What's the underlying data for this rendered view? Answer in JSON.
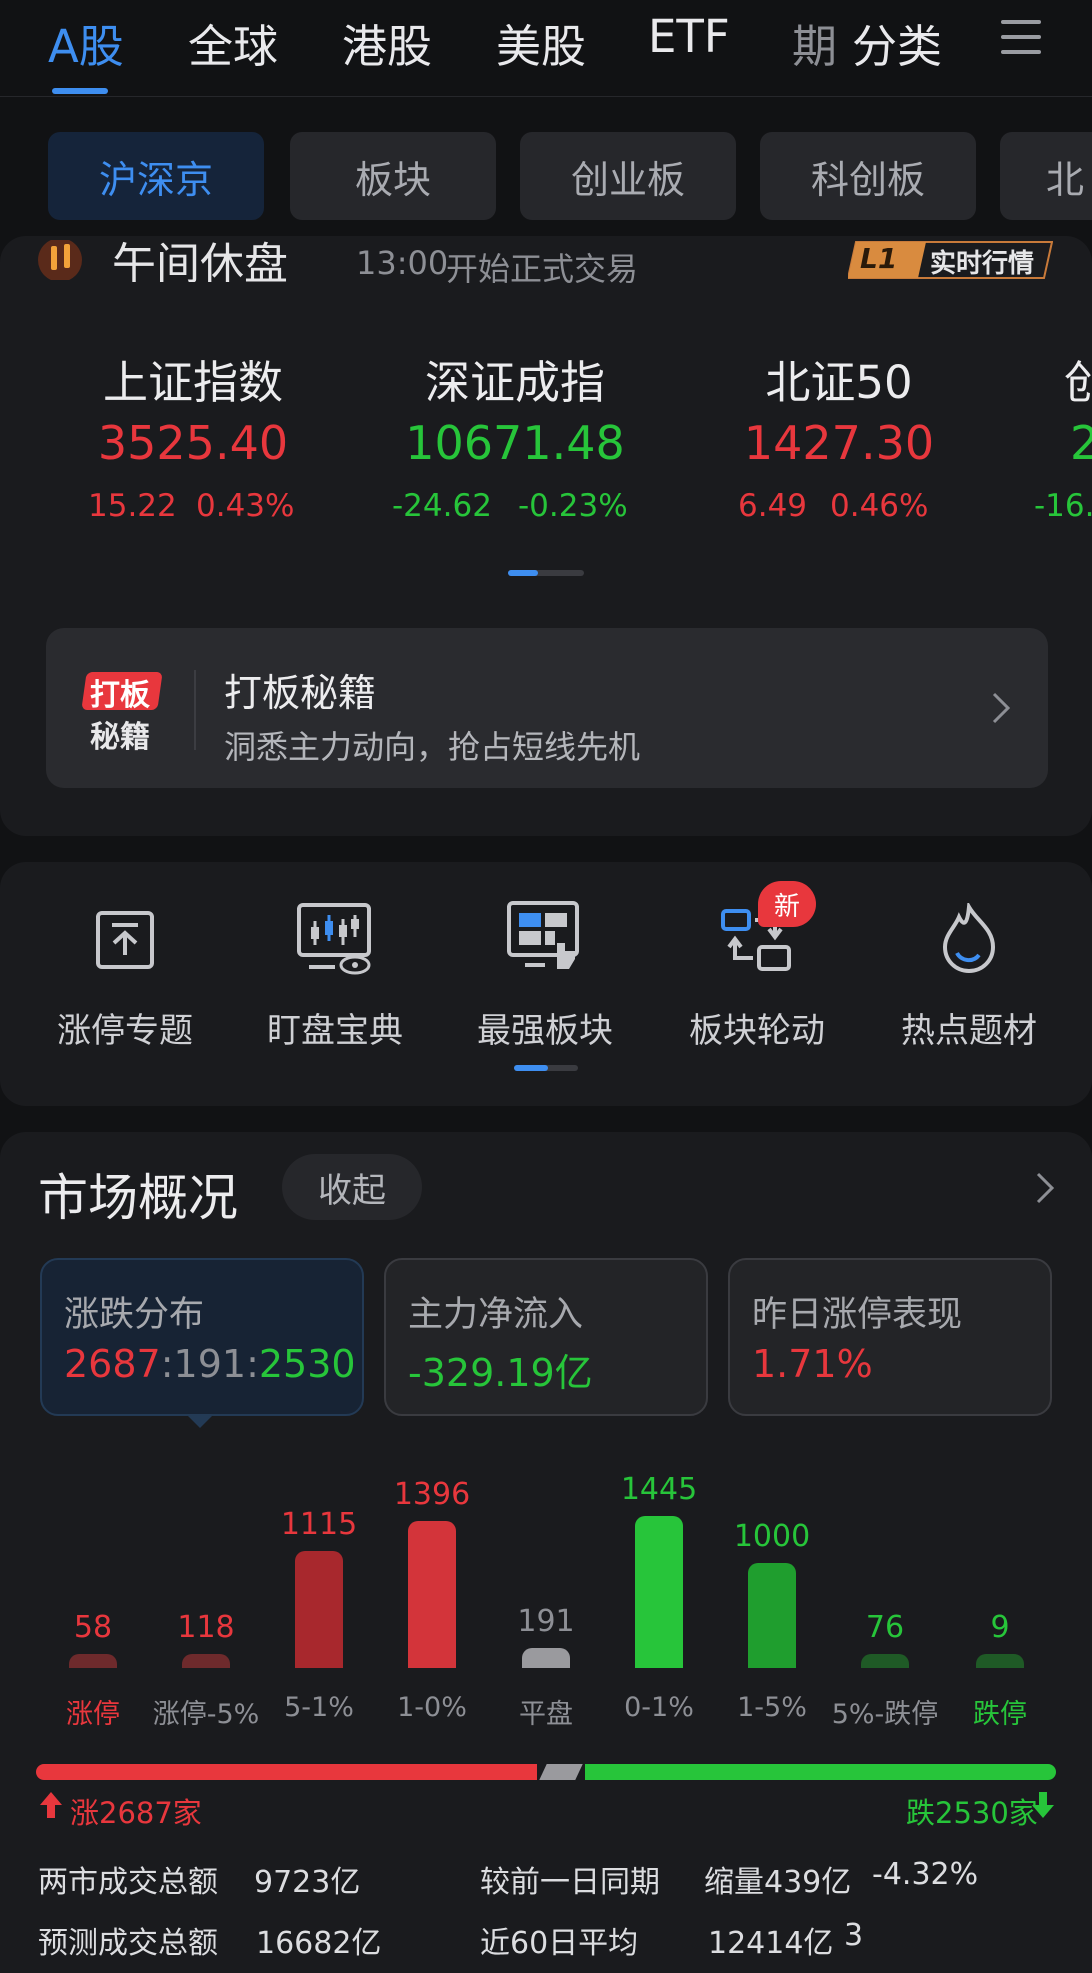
{
  "top_nav": {
    "tabs": [
      "A股",
      "全球",
      "港股",
      "美股",
      "ETF",
      "期",
      "分类"
    ],
    "active": "A股"
  },
  "sub_tabs": {
    "items": [
      "沪深京",
      "板块",
      "创业板",
      "科创板",
      "北"
    ],
    "active": "沪深京"
  },
  "market_status": {
    "title": "午间休盘",
    "time": "13:00",
    "note": "开始正式交易",
    "badge_code": "L1",
    "badge_text": "实时行情"
  },
  "indices": [
    {
      "name": "上证指数",
      "value": "3525.40",
      "change": "15.22",
      "pct": "0.43%",
      "dir": "up"
    },
    {
      "name": "深证成指",
      "value": "10671.48",
      "change": "-24.62",
      "pct": "-0.23%",
      "dir": "down"
    },
    {
      "name": "北证50",
      "value": "1427.30",
      "change": "6.49",
      "pct": "0.46%",
      "dir": "up"
    },
    {
      "name": "创",
      "value": "2",
      "change": "-16.",
      "pct": "",
      "dir": "down"
    }
  ],
  "promo": {
    "icon_text_1": "打板",
    "icon_text_2": "秘籍",
    "title": "打板秘籍",
    "subtitle": "洞悉主力动向，抢占短线先机"
  },
  "tools": [
    {
      "label": "涨停专题",
      "icon": "upload-box-icon"
    },
    {
      "label": "盯盘宝典",
      "icon": "monitor-candlestick-icon"
    },
    {
      "label": "最强板块",
      "icon": "dashboard-hand-icon"
    },
    {
      "label": "板块轮动",
      "icon": "rotate-cards-icon",
      "badge": "新"
    },
    {
      "label": "热点题材",
      "icon": "flame-icon"
    }
  ],
  "overview": {
    "title": "市场概况",
    "collapse_label": "收起",
    "cards": [
      {
        "title": "涨跌分布",
        "up": "2687",
        "sep1": ":",
        "flat": "191",
        "sep2": ":",
        "down": "2530"
      },
      {
        "title": "主力净流入",
        "value": "-329.19亿"
      },
      {
        "title": "昨日涨停表现",
        "value": "1.71%"
      }
    ]
  },
  "chart_data": {
    "type": "bar",
    "categories": [
      "涨停",
      "涨停-5%",
      "5-1%",
      "1-0%",
      "平盘",
      "0-1%",
      "1-5%",
      "5%-跌停",
      "跌停"
    ],
    "values": [
      58,
      118,
      1115,
      1396,
      191,
      1445,
      1000,
      76,
      9
    ],
    "colors": [
      "#6e2a2c",
      "#6e2a2c",
      "#a8282d",
      "#d3343a",
      "#9a9a9e",
      "#27c53a",
      "#1f9e2e",
      "#1f5a26",
      "#1f5a26"
    ],
    "label_colors": [
      "#e8373d",
      "#8d8f95",
      "#8d8f95",
      "#8d8f95",
      "#8d8f95",
      "#8d8f95",
      "#8d8f95",
      "#8d8f95",
      "#27c53a"
    ],
    "value_colors": [
      "#e8373d",
      "#e8373d",
      "#e8373d",
      "#e8373d",
      "#8d8f95",
      "#27c53a",
      "#27c53a",
      "#27c53a",
      "#27c53a"
    ]
  },
  "breadth": {
    "up_label": "涨2687家",
    "down_label": "跌2530家",
    "up": 2687,
    "flat": 191,
    "down": 2530
  },
  "summary": {
    "total_label": "两市成交总额",
    "total_value": "9723亿",
    "compare_label": "较前一日同期",
    "compare_value": "缩量439亿",
    "compare_pct": "-4.32%",
    "forecast_label": "预测成交总额",
    "forecast_value": "16682亿",
    "avg_label": "近60日平均",
    "avg_value": "12414亿",
    "avg_extra": "3"
  },
  "colors": {
    "up": "#e8373d",
    "down": "#27c53a",
    "accent": "#3e8ef0",
    "background": "#111214"
  }
}
